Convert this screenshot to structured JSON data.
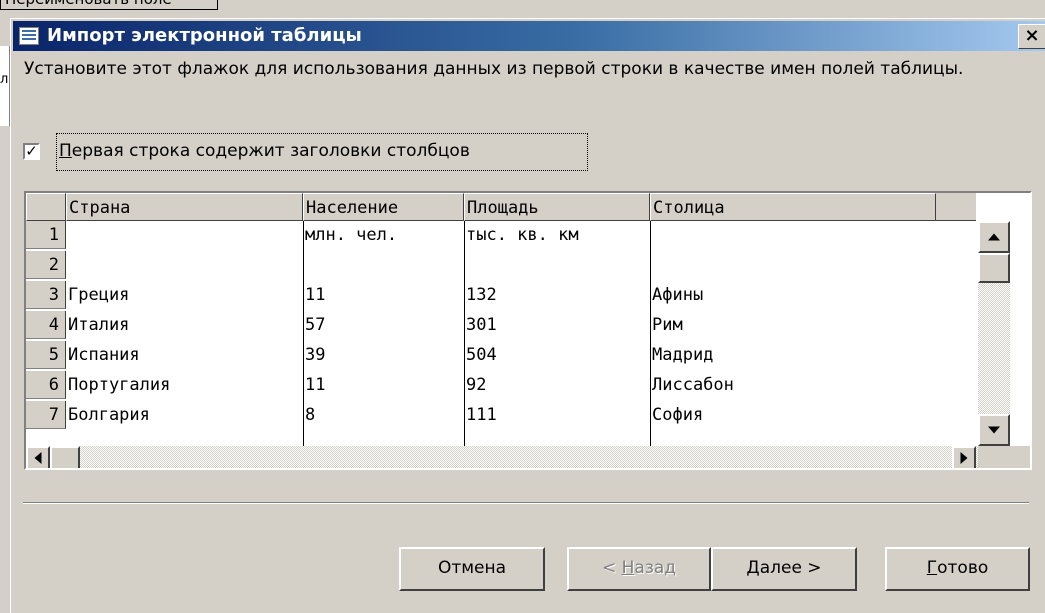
{
  "background": {
    "button_label": "Переименовать поле",
    "left_text": "л"
  },
  "dialog": {
    "title": "Импорт электронной таблицы",
    "close_glyph": "×",
    "instructions": "Установите этот флажок для использования данных из первой строки в качестве имен полей таблицы.",
    "checkbox": {
      "checked": true,
      "check_glyph": "✓",
      "label_first": "П",
      "label_rest": "ервая строка содержит заголовки столбцов"
    }
  },
  "grid": {
    "columns": [
      "Страна",
      "Население",
      "Площадь",
      "Столица"
    ],
    "rows": [
      {
        "num": "1",
        "cells": [
          "",
          "млн. чел.",
          "тыс. кв. км",
          ""
        ]
      },
      {
        "num": "2",
        "cells": [
          "",
          "",
          "",
          ""
        ]
      },
      {
        "num": "3",
        "cells": [
          "Греция",
          "11",
          "132",
          "Афины"
        ]
      },
      {
        "num": "4",
        "cells": [
          "Италия",
          "57",
          "301",
          "Рим"
        ]
      },
      {
        "num": "5",
        "cells": [
          "Испания",
          "39",
          "504",
          "Мадрид"
        ]
      },
      {
        "num": "6",
        "cells": [
          "Португалия",
          "11",
          "92",
          "Лиссабон"
        ]
      },
      {
        "num": "7",
        "cells": [
          "Болгария",
          "8",
          "111",
          "София"
        ]
      }
    ]
  },
  "buttons": {
    "cancel": "Отмена",
    "back_prefix": "< ",
    "back_u": "Н",
    "back_rest": "азад",
    "next_u": "Д",
    "next_rest": "алее >",
    "finish_u": "Г",
    "finish_rest": "отово"
  }
}
